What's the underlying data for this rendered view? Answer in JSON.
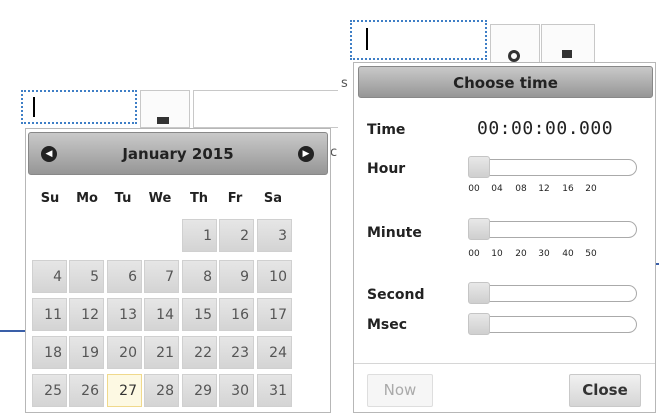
{
  "datepicker": {
    "title": "January 2015",
    "prev_icon": "circle-arrow-left-icon",
    "next_icon": "circle-arrow-right-icon",
    "weekdays": [
      "Su",
      "Mo",
      "Tu",
      "We",
      "Th",
      "Fr",
      "Sa"
    ],
    "weeks": [
      [
        "",
        "",
        "",
        "",
        "1",
        "2",
        "3"
      ],
      [
        "4",
        "5",
        "6",
        "7",
        "8",
        "9",
        "10"
      ],
      [
        "11",
        "12",
        "13",
        "14",
        "15",
        "16",
        "17"
      ],
      [
        "18",
        "19",
        "20",
        "21",
        "22",
        "23",
        "24"
      ],
      [
        "25",
        "26",
        "27",
        "28",
        "29",
        "30",
        "31"
      ]
    ],
    "today": "27"
  },
  "timepicker": {
    "title": "Choose time",
    "time_label": "Time",
    "time_value": "00:00:00.000",
    "hour_label": "Hour",
    "hour_ticks": [
      "00",
      "04",
      "08",
      "12",
      "16",
      "20"
    ],
    "minute_label": "Minute",
    "minute_ticks": [
      "00",
      "10",
      "20",
      "30",
      "40",
      "50"
    ],
    "second_label": "Second",
    "msec_label": "Msec",
    "hour_value": 0,
    "minute_value": 0,
    "second_value": 0,
    "msec_value": 0,
    "now_label": "Now",
    "close_label": "Close"
  },
  "background": {
    "partial_text_c": "c",
    "partial_text_s": "s"
  }
}
